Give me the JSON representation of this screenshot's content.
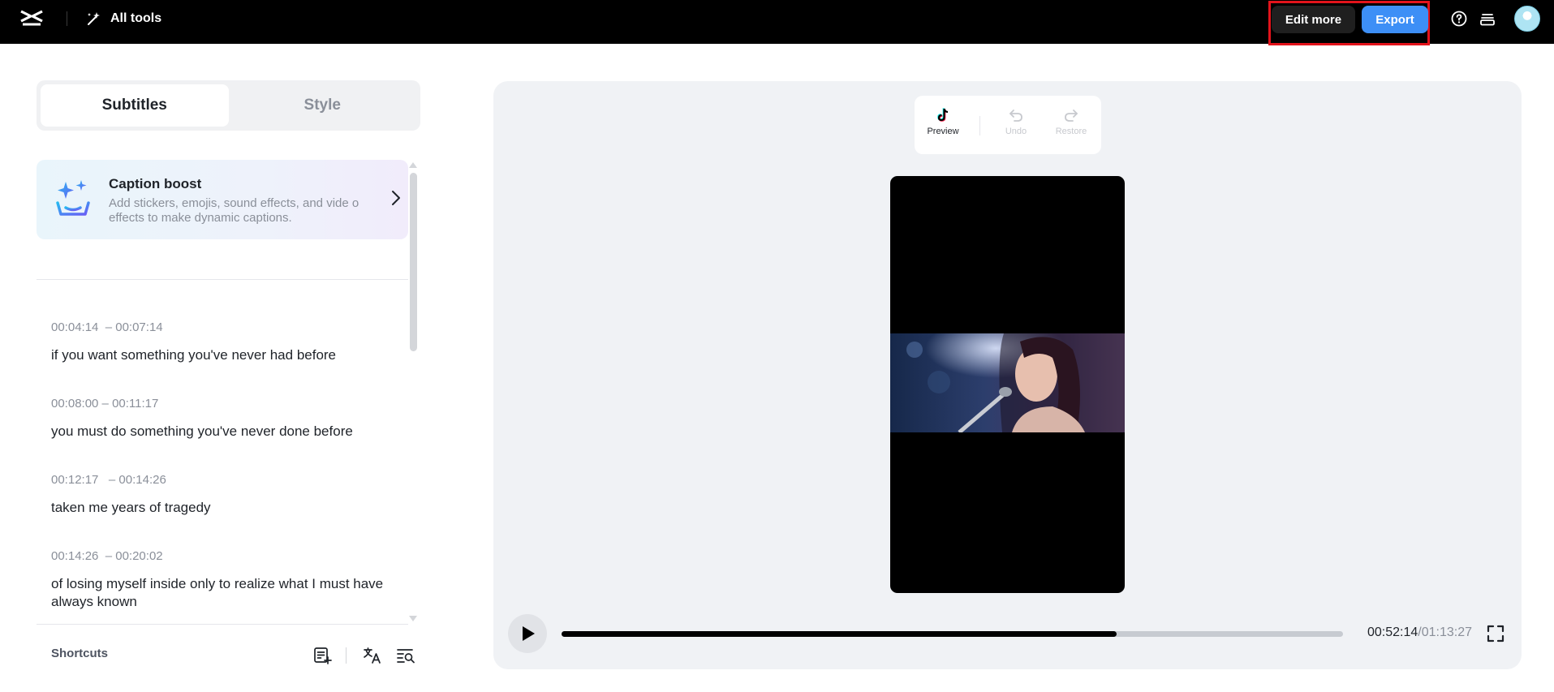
{
  "topbar": {
    "logo_icon": "capcut-logo-icon",
    "all_tools_label": "All tools",
    "edit_more_label": "Edit more",
    "export_label": "Export",
    "help_icon": "help-circle-icon",
    "layers_icon": "layers-icon"
  },
  "tabs": [
    {
      "label": "Subtitles",
      "active": true
    },
    {
      "label": "Style",
      "active": false
    }
  ],
  "caption_boost": {
    "title": "Caption boost",
    "description": "Add stickers, emojis, sound effects, and vide o effects to make dynamic captions."
  },
  "subtitles": [
    {
      "time": "00:04:14  – 00:07:14",
      "text": "if you want something you've never had before"
    },
    {
      "time": "00:08:00 – 00:11:17",
      "text": "you must do something you've never done before"
    },
    {
      "time": "00:12:17   – 00:14:26",
      "text": "taken me years of tragedy"
    },
    {
      "time": "00:14:26  – 00:20:02",
      "text": "of losing myself inside only to realize what I must have always known"
    }
  ],
  "bottom": {
    "shortcuts_label": "Shortcuts"
  },
  "toolbar": {
    "preview_label": "Preview",
    "undo_label": "Undo",
    "restore_label": "Restore"
  },
  "player": {
    "current_time": "00:52:14",
    "total_time": "/01:13:27",
    "progress_fraction": 0.71
  },
  "colors": {
    "accent": "#3d8ff6",
    "highlight": "#e3131b"
  }
}
